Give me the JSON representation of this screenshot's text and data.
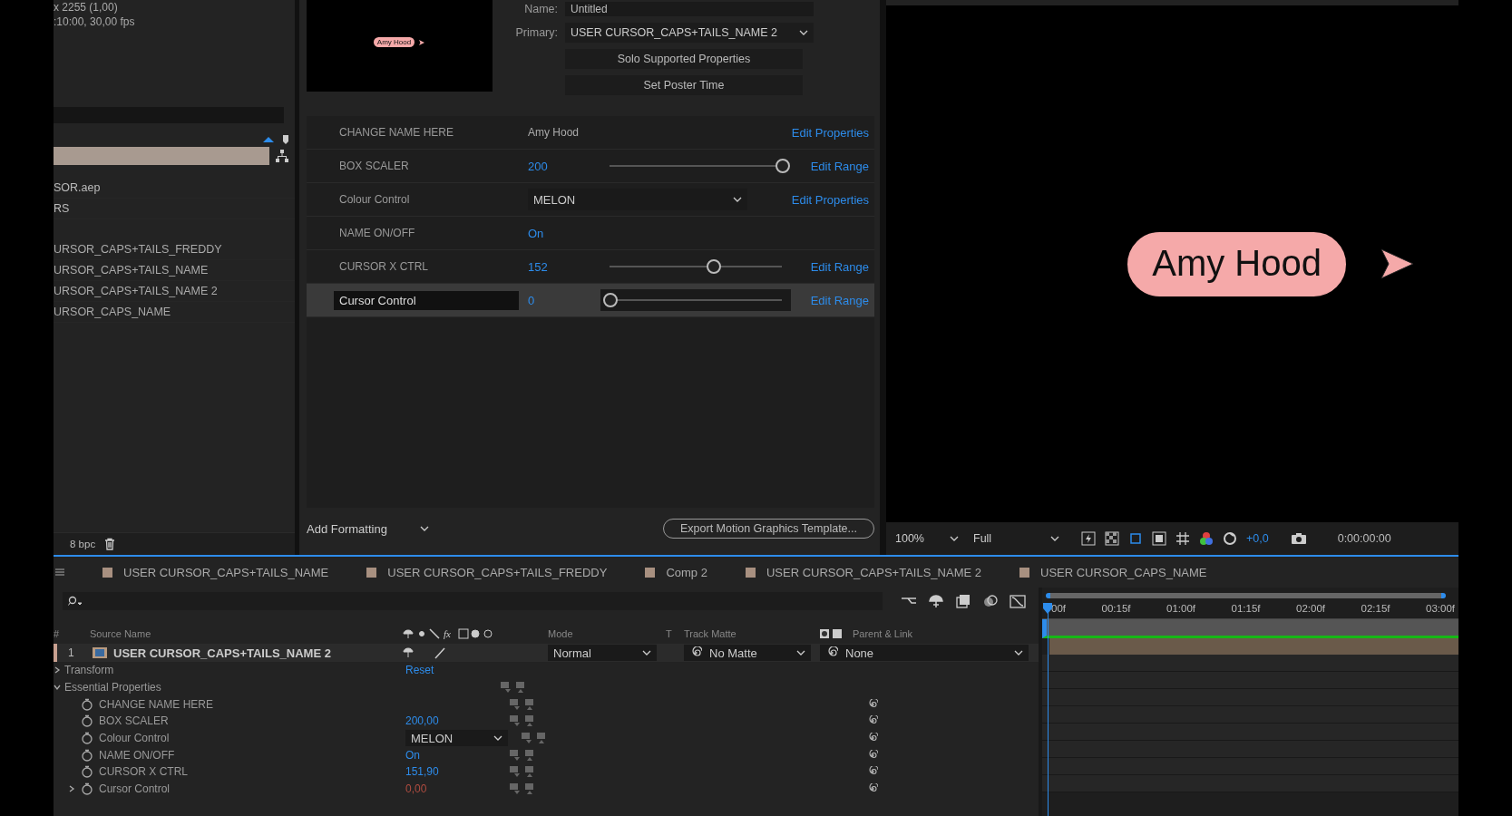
{
  "project": {
    "info": [
      "x 2255 (1,00)",
      ":10:00, 30,00 fps"
    ],
    "items": [
      {
        "label": "SOR.aep",
        "kind": "file"
      },
      {
        "label": "RS",
        "kind": "folder"
      },
      {
        "label": "URSOR_CAPS+TAILS_FREDDY",
        "kind": "comp"
      },
      {
        "label": "URSOR_CAPS+TAILS_NAME",
        "kind": "comp"
      },
      {
        "label": "URSOR_CAPS+TAILS_NAME 2",
        "kind": "comp"
      },
      {
        "label": "URSOR_CAPS_NAME",
        "kind": "comp"
      }
    ],
    "bit_depth": "8 bpc"
  },
  "essential_graphics": {
    "thumbnail_text": "Amy Hood",
    "name_label": "Name:",
    "name_value": "Untitled",
    "primary_label": "Primary:",
    "primary": "USER CURSOR_CAPS+TAILS_NAME 2",
    "buttons": [
      "Solo Supported Properties",
      "Set Poster Time"
    ],
    "properties": [
      {
        "kind": "text",
        "label": "CHANGE NAME HERE",
        "value": "Amy Hood",
        "action": "Edit Properties",
        "selected": false
      },
      {
        "kind": "slider",
        "label": "BOX SCALER",
        "value": "200",
        "level": 1,
        "action": "Edit Range",
        "selected": false
      },
      {
        "kind": "dropdown",
        "label": "Colour Control",
        "value": "MELON",
        "action": "Edit Properties",
        "selected": false
      },
      {
        "kind": "toggle",
        "label": "NAME ON/OFF",
        "value": "On",
        "selected": false
      },
      {
        "kind": "slider",
        "label": "CURSOR X CTRL",
        "value": "152",
        "level": 0.6,
        "action": "Edit Range",
        "selected": false
      },
      {
        "kind": "slider",
        "label": "Cursor Control",
        "value": "0",
        "level": 0,
        "action": "Edit Range",
        "selected": true
      }
    ],
    "add_formatting": "Add Formatting",
    "export": "Export Motion Graphics Template..."
  },
  "viewer": {
    "name_tag": "Amy Hood",
    "zoom": "100%",
    "resolution": "Full",
    "exposure": "+0,0",
    "timecode": "0:00:00:00"
  },
  "timeline": {
    "tabs": [
      "USER CURSOR_CAPS+TAILS_NAME",
      "USER CURSOR_CAPS+TAILS_FREDDY",
      "Comp 2",
      "USER CURSOR_CAPS+TAILS_NAME 2",
      "USER CURSOR_CAPS_NAME"
    ],
    "columns": [
      "#",
      "Source Name",
      "Mode",
      "T",
      "Track Matte",
      "Parent & Link"
    ],
    "effects_switch": "fx",
    "layer": {
      "number": "1",
      "name": "USER CURSOR_CAPS+TAILS_NAME 2",
      "mode": "Normal",
      "matte": "No Matte",
      "parent": "None"
    },
    "transform": {
      "label": "Transform",
      "action": "Reset",
      "expanded": false
    },
    "group": {
      "label": "Essential Properties",
      "expanded": true,
      "children": [
        {
          "kind": "text",
          "label": "CHANGE NAME HERE",
          "expandable": false
        },
        {
          "kind": "number",
          "label": "BOX SCALER",
          "value": "200,00",
          "expandable": false
        },
        {
          "kind": "dropdown",
          "label": "Colour Control",
          "value": "MELON",
          "expandable": false
        },
        {
          "kind": "number",
          "label": "NAME ON/OFF",
          "value": "On",
          "expandable": false
        },
        {
          "kind": "number",
          "label": "CURSOR X CTRL",
          "value": "151,90",
          "expandable": false
        },
        {
          "kind": "expression",
          "label": "Cursor Control",
          "value": "0,00",
          "expandable": true
        }
      ]
    },
    "ruler_labels": [
      "00f",
      "00:15f",
      "01:00f",
      "01:15f",
      "02:00f",
      "02:15f",
      "03:00f"
    ]
  }
}
